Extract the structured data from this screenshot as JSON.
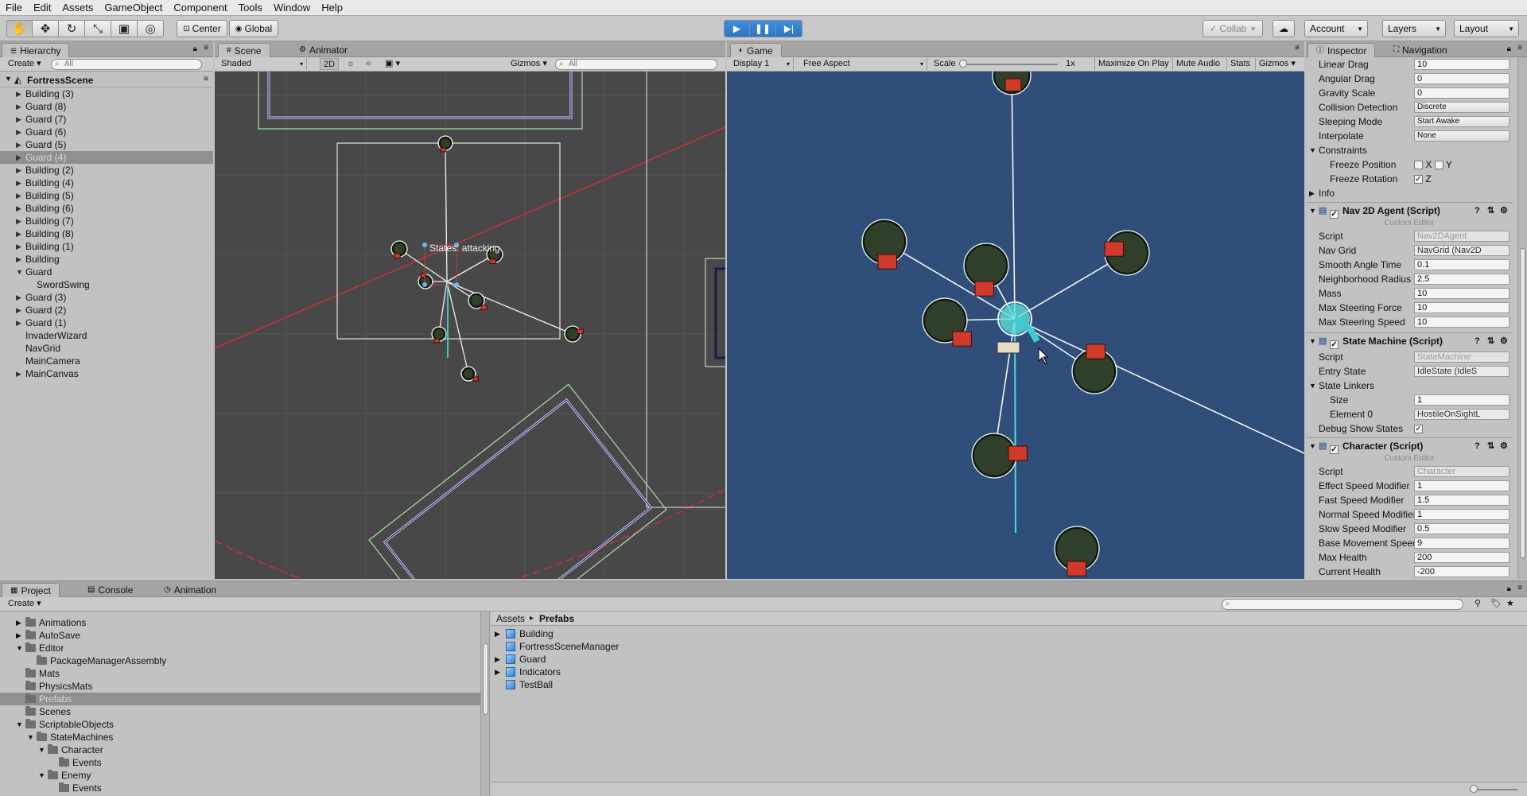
{
  "menu": [
    "File",
    "Edit",
    "Assets",
    "GameObject",
    "Component",
    "Tools",
    "Window",
    "Help"
  ],
  "toolbar": {
    "pivot": "Center",
    "space": "Global",
    "collab": "Collab",
    "account": "Account",
    "layers": "Layers",
    "layout": "Layout"
  },
  "hierarchy": {
    "tab": "Hierarchy",
    "create": "Create",
    "search": "All",
    "scene": "FortressScene",
    "items": [
      {
        "label": "Building (3)",
        "arrow": "▶",
        "indent": 0
      },
      {
        "label": "Guard (8)",
        "arrow": "▶",
        "indent": 0
      },
      {
        "label": "Guard (7)",
        "arrow": "▶",
        "indent": 0
      },
      {
        "label": "Guard (6)",
        "arrow": "▶",
        "indent": 0
      },
      {
        "label": "Guard (5)",
        "arrow": "▶",
        "indent": 0
      },
      {
        "label": "Guard (4)",
        "arrow": "▶",
        "indent": 0,
        "selected": true
      },
      {
        "label": "Building (2)",
        "arrow": "▶",
        "indent": 0
      },
      {
        "label": "Building (4)",
        "arrow": "▶",
        "indent": 0
      },
      {
        "label": "Building (5)",
        "arrow": "▶",
        "indent": 0
      },
      {
        "label": "Building (6)",
        "arrow": "▶",
        "indent": 0
      },
      {
        "label": "Building (7)",
        "arrow": "▶",
        "indent": 0
      },
      {
        "label": "Building (8)",
        "arrow": "▶",
        "indent": 0
      },
      {
        "label": "Building (1)",
        "arrow": "▶",
        "indent": 0
      },
      {
        "label": "Building",
        "arrow": "▶",
        "indent": 0
      },
      {
        "label": "Guard",
        "arrow": "▼",
        "indent": 0
      },
      {
        "label": "SwordSwing",
        "arrow": "",
        "indent": 1
      },
      {
        "label": "Guard (3)",
        "arrow": "▶",
        "indent": 0
      },
      {
        "label": "Guard (2)",
        "arrow": "▶",
        "indent": 0
      },
      {
        "label": "Guard (1)",
        "arrow": "▶",
        "indent": 0
      },
      {
        "label": "InvaderWizard",
        "arrow": "",
        "indent": 0
      },
      {
        "label": "NavGrid",
        "arrow": "",
        "indent": 0
      },
      {
        "label": "MainCamera",
        "arrow": "",
        "indent": 0
      },
      {
        "label": "MainCanvas",
        "arrow": "▶",
        "indent": 0
      }
    ]
  },
  "scene": {
    "tab_scene": "Scene",
    "tab_animator": "Animator",
    "shading": "Shaded",
    "mode2d": "2D",
    "gizmos": "Gizmos",
    "search": "All",
    "state_label": "States: attacking"
  },
  "game": {
    "tab": "Game",
    "display": "Display 1",
    "aspect": "Free Aspect",
    "scale_label": "Scale",
    "scale_value": "1x",
    "maximize": "Maximize On Play",
    "mute": "Mute Audio",
    "stats": "Stats",
    "gizmos": "Gizmos"
  },
  "inspector": {
    "tab": "Inspector",
    "tab_nav": "Navigation",
    "rigidbody": [
      {
        "label": "Linear Drag",
        "value": "10"
      },
      {
        "label": "Angular Drag",
        "value": "0"
      },
      {
        "label": "Gravity Scale",
        "value": "0"
      },
      {
        "label": "Collision Detection",
        "value": "Discrete",
        "drop": true
      },
      {
        "label": "Sleeping Mode",
        "value": "Start Awake",
        "drop": true
      },
      {
        "label": "Interpolate",
        "value": "None",
        "drop": true
      }
    ],
    "constraints": "Constraints",
    "freeze_pos": "Freeze Position",
    "freeze_rot": "Freeze Rotation",
    "x": "X",
    "y": "Y",
    "z": "Z",
    "info": "Info",
    "nav_title": "Nav 2D Agent (Script)",
    "custom_editor": "Custom Editor",
    "nav": [
      {
        "label": "Script",
        "value": "Nav2DAgent",
        "kind": "dim"
      },
      {
        "label": "Nav Grid",
        "value": "NavGrid (Nav2D",
        "kind": "obj"
      },
      {
        "label": "Smooth Angle Time",
        "value": "0.1"
      },
      {
        "label": "Neighborhood Radius",
        "value": "2.5"
      },
      {
        "label": "Mass",
        "value": "10"
      },
      {
        "label": "Max Steering Force",
        "value": "10"
      },
      {
        "label": "Max Steering Speed",
        "value": "10"
      }
    ],
    "sm_title": "State Machine (Script)",
    "sm": [
      {
        "label": "Script",
        "value": "StateMachine",
        "kind": "dim"
      },
      {
        "label": "Entry State",
        "value": "IdleState (IdleS",
        "kind": "obj"
      }
    ],
    "linkers": "State Linkers",
    "size_label": "Size",
    "size_value": "1",
    "el0_label": "Element 0",
    "el0_value": "HostileOnSightL",
    "debug": "Debug Show States",
    "char_title": "Character (Script)",
    "char": [
      {
        "label": "Script",
        "value": "Character",
        "kind": "dim"
      },
      {
        "label": "Effect Speed Modifier",
        "value": "1"
      },
      {
        "label": "Fast Speed Modifier",
        "value": "1.5"
      },
      {
        "label": "Normal Speed Modifier",
        "value": "1"
      },
      {
        "label": "Slow Speed Modifier",
        "value": "0.5"
      },
      {
        "label": "Base Movement Speed",
        "value": "9"
      },
      {
        "label": "Max Health",
        "value": "200"
      },
      {
        "label": "Current Health",
        "value": "-200"
      }
    ]
  },
  "project": {
    "tab_project": "Project",
    "tab_console": "Console",
    "tab_animation": "Animation",
    "create": "Create",
    "tree": [
      {
        "label": "Animations",
        "arrow": "▶",
        "indent": 0
      },
      {
        "label": "AutoSave",
        "arrow": "▶",
        "indent": 0
      },
      {
        "label": "Editor",
        "arrow": "▼",
        "indent": 0
      },
      {
        "label": "PackageManagerAssembly",
        "arrow": "",
        "indent": 1
      },
      {
        "label": "Mats",
        "arrow": "",
        "indent": 0
      },
      {
        "label": "PhysicsMats",
        "arrow": "",
        "indent": 0
      },
      {
        "label": "Prefabs",
        "arrow": "",
        "indent": 0,
        "selected": true
      },
      {
        "label": "Scenes",
        "arrow": "",
        "indent": 0
      },
      {
        "label": "ScriptableObjects",
        "arrow": "▼",
        "indent": 0
      },
      {
        "label": "StateMachines",
        "arrow": "▼",
        "indent": 1
      },
      {
        "label": "Character",
        "arrow": "▼",
        "indent": 2
      },
      {
        "label": "Events",
        "arrow": "",
        "indent": 3
      },
      {
        "label": "Enemy",
        "arrow": "▼",
        "indent": 2
      },
      {
        "label": "Events",
        "arrow": "",
        "indent": 3
      }
    ],
    "breadcrumb_root": "Assets",
    "breadcrumb_sep": "▸",
    "breadcrumb_current": "Prefabs",
    "assets": [
      {
        "label": "Building",
        "arrow": "▶"
      },
      {
        "label": "FortressSceneManager",
        "arrow": ""
      },
      {
        "label": "Guard",
        "arrow": "▶"
      },
      {
        "label": "Indicators",
        "arrow": "▶"
      },
      {
        "label": "TestBall",
        "arrow": ""
      }
    ]
  }
}
